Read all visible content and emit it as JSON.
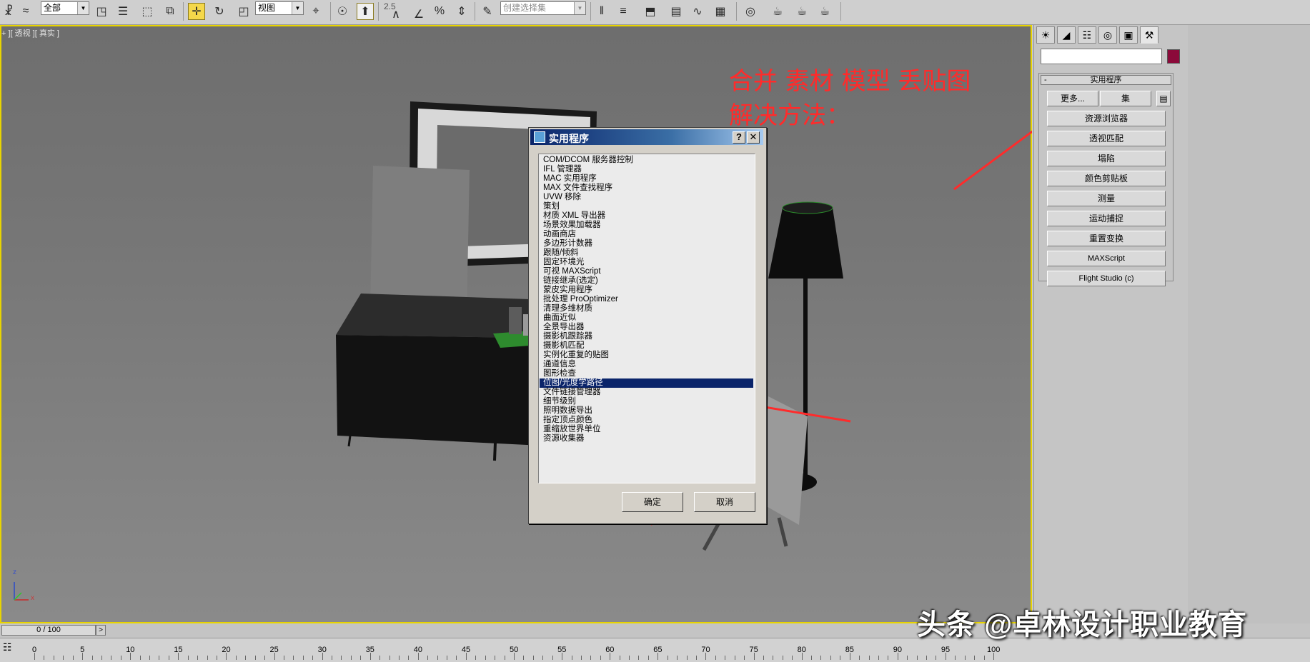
{
  "toolbar": {
    "selection_filter": "全部",
    "reference_coord": "视图",
    "spinner_value": "2.5",
    "named_selection_placeholder": "创建选择集"
  },
  "viewport": {
    "label": "+ ][ 透视 ][ 真实 ]",
    "annotation_line1": "合并  素材  模型  丢贴图",
    "annotation_line2": "解决方法：",
    "axis_labels": {
      "z": "z",
      "x": "x"
    }
  },
  "dialog": {
    "title": "实用程序",
    "help_button": "?",
    "close_button": "✕",
    "items": [
      "COM/DCOM 服务器控制",
      "IFL 管理器",
      "MAC 实用程序",
      "MAX 文件查找程序",
      "UVW 移除",
      "策划",
      "材质 XML 导出器",
      "场景效果加载器",
      "动画商店",
      "多边形计数器",
      "跟随/倾斜",
      "固定环境光",
      "可视 MAXScript",
      "链接继承(选定)",
      "蒙皮实用程序",
      "批处理 ProOptimizer",
      "清理多维材质",
      "曲面近似",
      "全景导出器",
      "摄影机跟踪器",
      "摄影机匹配",
      "实例化重复的贴图",
      "通道信息",
      "图形检查",
      "位图/光度学路径",
      "文件链接管理器",
      "细节级别",
      "照明数据导出",
      "指定顶点颜色",
      "重缩放世界单位",
      "资源收集器"
    ],
    "selected_index": 24,
    "ok_label": "确定",
    "cancel_label": "取消"
  },
  "panel": {
    "rollout_title": "实用程序",
    "rollout_collapse": "-",
    "more_label": "更多...",
    "sets_label": "集",
    "utilities": [
      "资源浏览器",
      "透视匹配",
      "塌陷",
      "颜色剪贴板",
      "测量",
      "运动捕捉",
      "重置变换",
      "MAXScript",
      "Flight Studio (c)"
    ],
    "swatch_color": "#8b0a3a"
  },
  "timeline": {
    "frame_display": "0 / 100",
    "next_label": ">",
    "ticks": [
      "0",
      "5",
      "10",
      "15",
      "20",
      "25",
      "30",
      "35",
      "40",
      "45",
      "50",
      "55",
      "60",
      "65",
      "70",
      "75",
      "80",
      "85",
      "90",
      "95",
      "100"
    ]
  },
  "watermark": "头条 @卓林设计职业教育"
}
